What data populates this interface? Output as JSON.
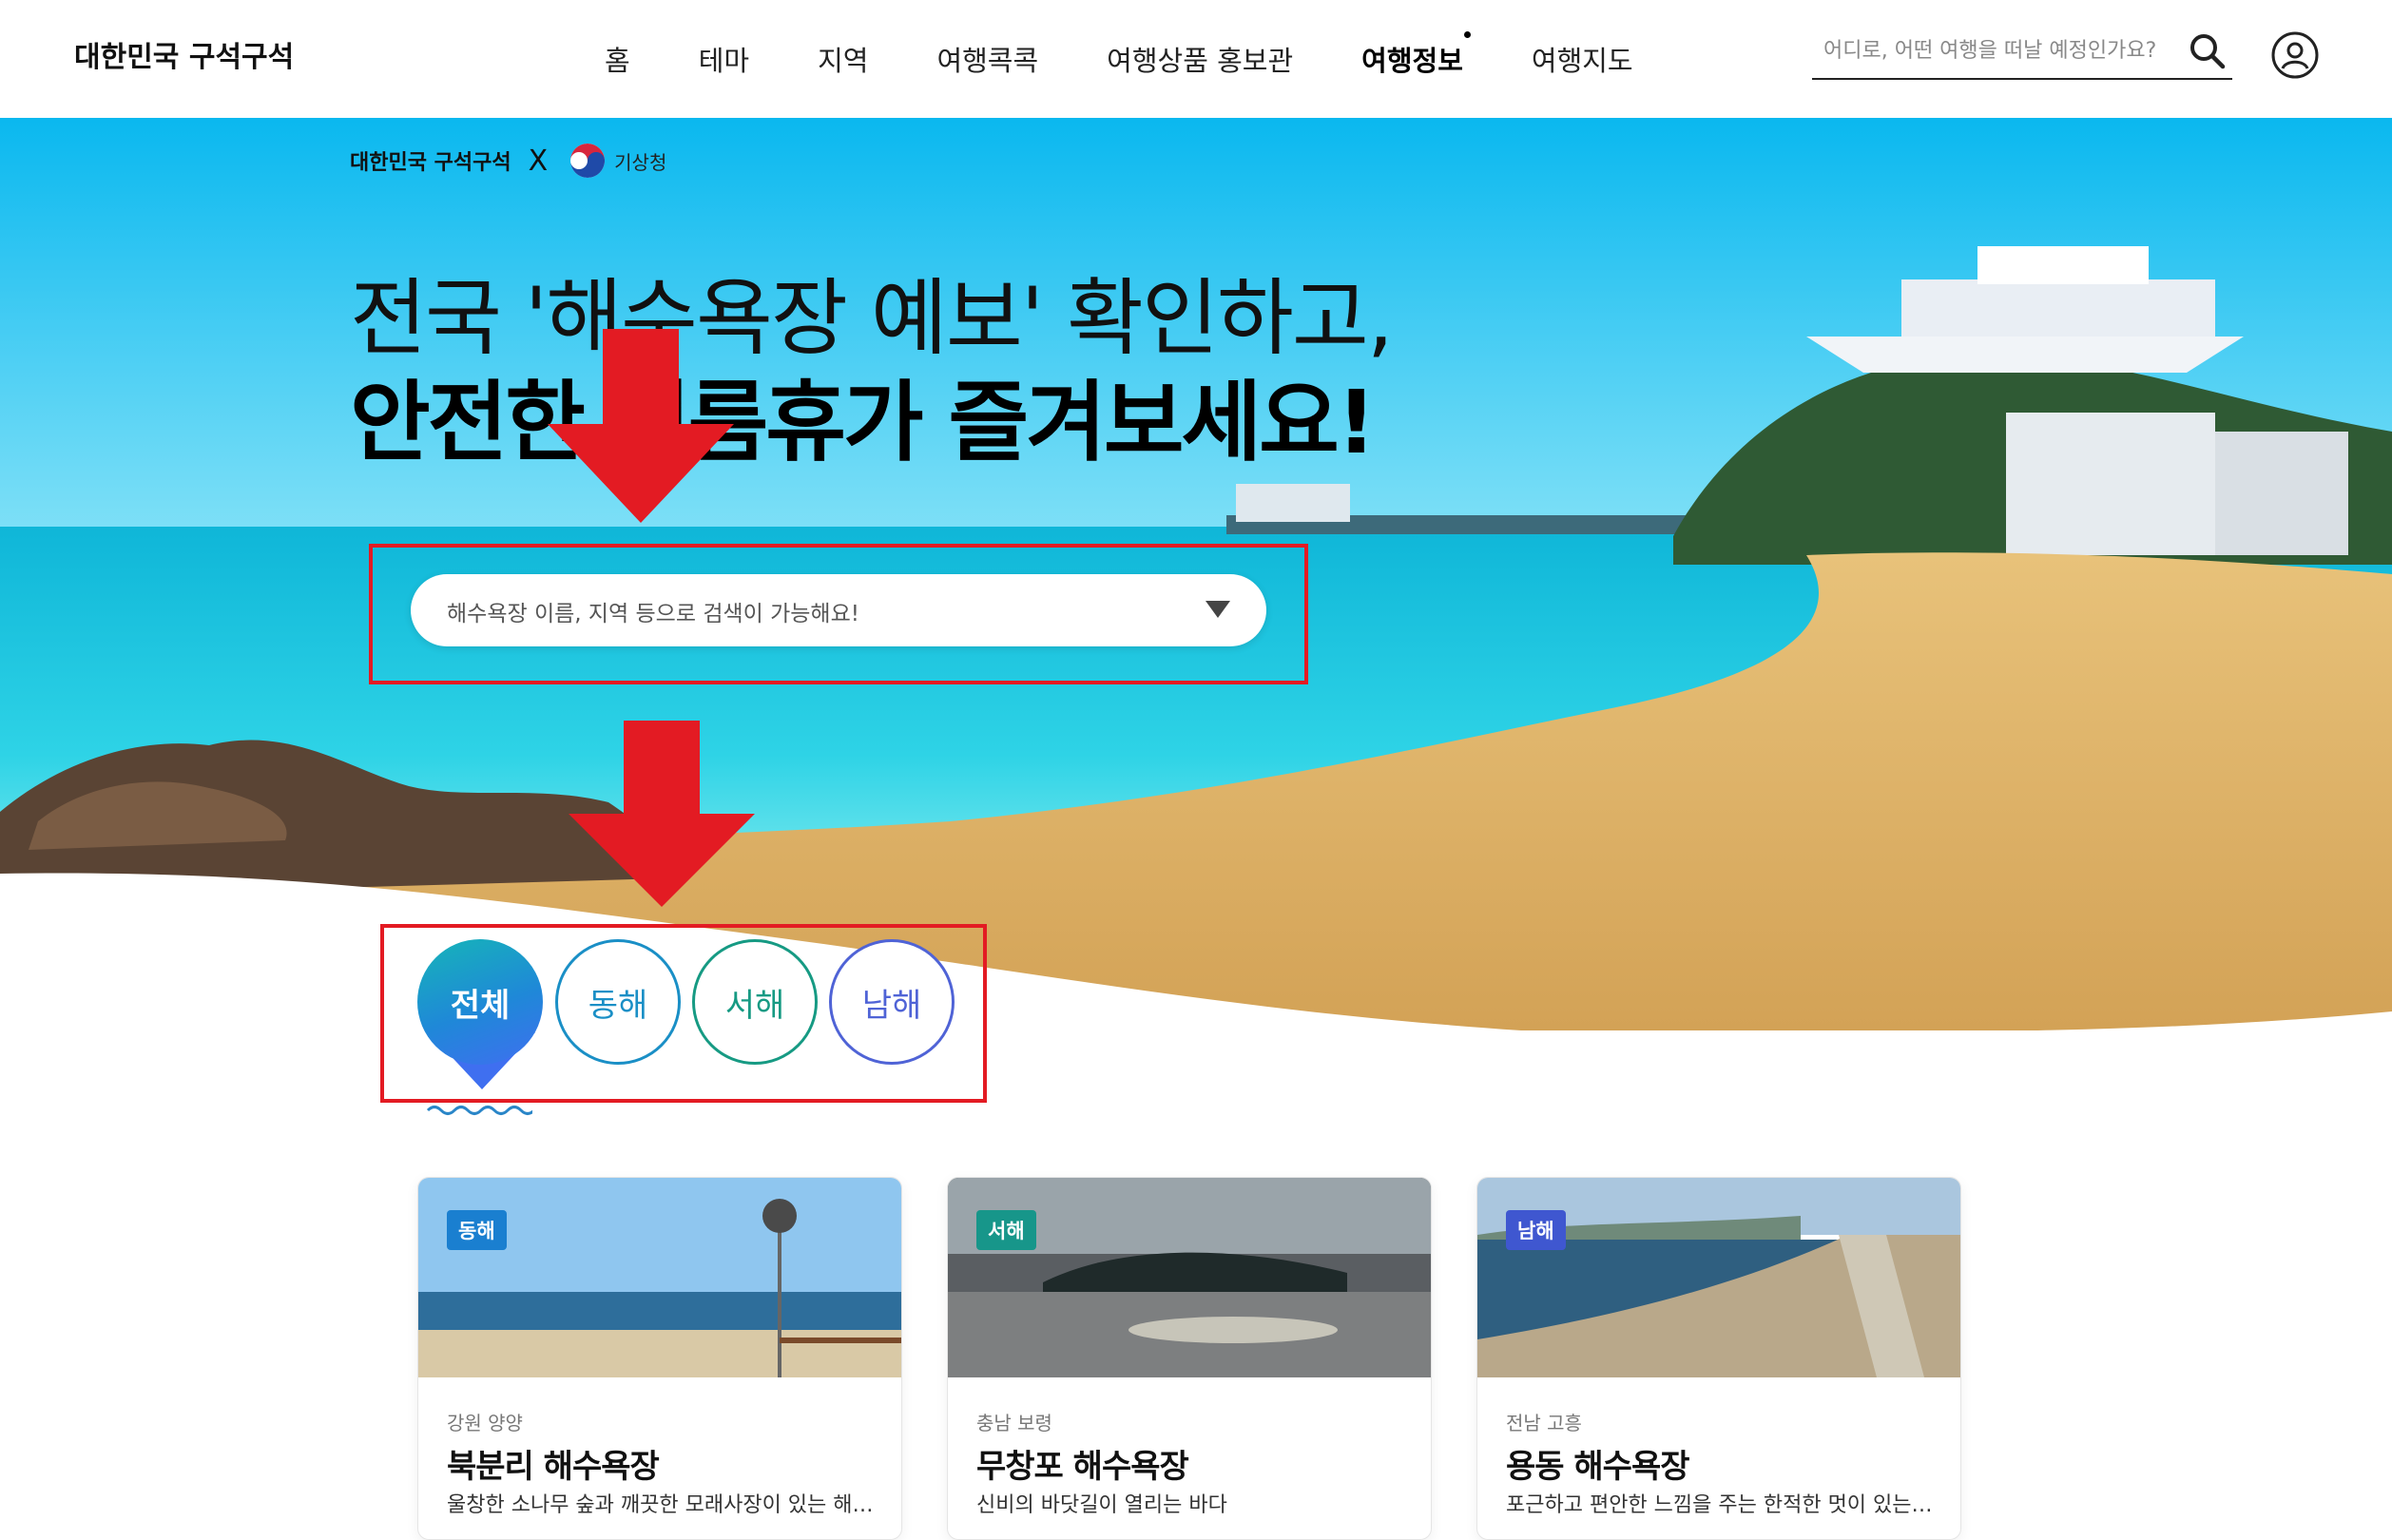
{
  "header": {
    "logo": "대한민국 구석구석",
    "nav": [
      "홈",
      "테마",
      "지역",
      "여행콕콕",
      "여행상품 홍보관",
      "여행정보",
      "여행지도"
    ],
    "active_nav": "여행정보",
    "search_placeholder": "어디로, 어떤 여행을 떠날 예정인가요?",
    "icons": {
      "search": "search-icon",
      "profile": "user-icon"
    }
  },
  "hero": {
    "collab_brand": "대한민국 구석구석",
    "collab_x": "X",
    "collab_partner": "기상청",
    "headline_line1": "전국 '해수욕장 예보' 확인하고,",
    "headline_line2": "안전한 여름휴가 즐겨보세요!",
    "select_placeholder": "해수욕장 이름, 지역 등으로 검색이 가능해요!",
    "colors": {
      "annotation_red": "#e31b23"
    }
  },
  "filters": {
    "items": [
      "전체",
      "동해",
      "서해",
      "남해"
    ],
    "selected": "전체",
    "colors": {
      "east": "#1a8fc6",
      "west": "#169a83",
      "south": "#4f63d6"
    }
  },
  "cards": [
    {
      "badge": "동해",
      "badge_color": "#1a7fd0",
      "region": "강원 양양",
      "title": "북분리 해수욕장",
      "desc": "울창한 소나무 숲과 깨끗한 모래사장이 있는 해수욕장"
    },
    {
      "badge": "서해",
      "badge_color": "#17968a",
      "region": "충남 보령",
      "title": "무창포 해수욕장",
      "desc": "신비의 바닷길이 열리는 바다"
    },
    {
      "badge": "남해",
      "badge_color": "#3f57d0",
      "region": "전남 고흥",
      "title": "용동 해수욕장",
      "desc": "포근하고 편안한 느낌을 주는 한적한 멋이 있는 해수욕장"
    }
  ]
}
